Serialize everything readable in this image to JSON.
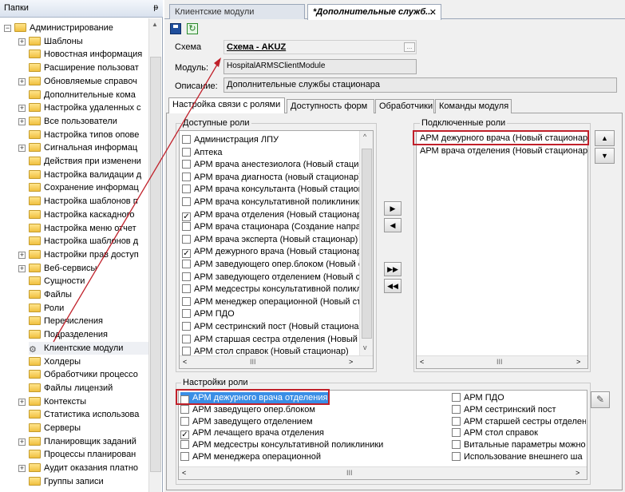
{
  "left_panel": {
    "title": "Папки",
    "pin": "ᵽ",
    "tree": [
      {
        "label": "Администрирование",
        "level": 0,
        "toggle": "−",
        "icon": "folder"
      },
      {
        "label": "Шаблоны",
        "level": 1,
        "toggle": "+",
        "icon": "folder"
      },
      {
        "label": "Новостная информация",
        "level": 1,
        "toggle": "",
        "icon": "folder"
      },
      {
        "label": "Расширение пользоват",
        "level": 1,
        "toggle": "",
        "icon": "folder"
      },
      {
        "label": "Обновляемые справоч",
        "level": 1,
        "toggle": "+",
        "icon": "folder"
      },
      {
        "label": "Дополнительные кома",
        "level": 1,
        "toggle": "",
        "icon": "folder"
      },
      {
        "label": "Настройка удаленных с",
        "level": 1,
        "toggle": "+",
        "icon": "folder"
      },
      {
        "label": "Все пользователи",
        "level": 1,
        "toggle": "+",
        "icon": "folder"
      },
      {
        "label": "Настройка типов опове",
        "level": 1,
        "toggle": "",
        "icon": "folder"
      },
      {
        "label": "Сигнальная информац",
        "level": 1,
        "toggle": "+",
        "icon": "folder"
      },
      {
        "label": "Действия при изменени",
        "level": 1,
        "toggle": "",
        "icon": "folder"
      },
      {
        "label": "Настройка валидации д",
        "level": 1,
        "toggle": "",
        "icon": "folder"
      },
      {
        "label": "Сохранение информац",
        "level": 1,
        "toggle": "",
        "icon": "folder"
      },
      {
        "label": "Настройка шаблонов п",
        "level": 1,
        "toggle": "",
        "icon": "folder"
      },
      {
        "label": "Настройка каскадного",
        "level": 1,
        "toggle": "",
        "icon": "folder"
      },
      {
        "label": "Настройка меню отчет",
        "level": 1,
        "toggle": "",
        "icon": "folder"
      },
      {
        "label": "Настройка шаблонов д",
        "level": 1,
        "toggle": "",
        "icon": "folder"
      },
      {
        "label": "Настройки прав доступ",
        "level": 1,
        "toggle": "+",
        "icon": "folder"
      },
      {
        "label": "Веб-сервисы",
        "level": 1,
        "toggle": "+",
        "icon": "folder"
      },
      {
        "label": "Сущности",
        "level": 1,
        "toggle": "",
        "icon": "folder"
      },
      {
        "label": "Файлы",
        "level": 1,
        "toggle": "",
        "icon": "folder"
      },
      {
        "label": "Роли",
        "level": 1,
        "toggle": "",
        "icon": "folder"
      },
      {
        "label": "Перечисления",
        "level": 1,
        "toggle": "",
        "icon": "folder"
      },
      {
        "label": "Подразделения",
        "level": 1,
        "toggle": "",
        "icon": "folder"
      },
      {
        "label": "Клиентские модули",
        "level": 1,
        "toggle": "",
        "icon": "gear",
        "selected": true
      },
      {
        "label": "Холдеры",
        "level": 1,
        "toggle": "",
        "icon": "folder"
      },
      {
        "label": "Обработчики процессо",
        "level": 1,
        "toggle": "",
        "icon": "folder"
      },
      {
        "label": "Файлы лицензий",
        "level": 1,
        "toggle": "",
        "icon": "folder"
      },
      {
        "label": "Контексты",
        "level": 1,
        "toggle": "+",
        "icon": "folder"
      },
      {
        "label": "Статистика использова",
        "level": 1,
        "toggle": "",
        "icon": "folder"
      },
      {
        "label": "Серверы",
        "level": 1,
        "toggle": "",
        "icon": "folder"
      },
      {
        "label": "Планировщик заданий",
        "level": 1,
        "toggle": "+",
        "icon": "folder"
      },
      {
        "label": "Процессы планирован",
        "level": 1,
        "toggle": "",
        "icon": "folder"
      },
      {
        "label": "Аудит оказания платно",
        "level": 1,
        "toggle": "+",
        "icon": "folder"
      },
      {
        "label": "Группы записи",
        "level": 1,
        "toggle": "",
        "icon": "folder"
      }
    ]
  },
  "doc_tabs": [
    {
      "label": "Клиентские модули",
      "active": false
    },
    {
      "label": "*Дополнительные служб...",
      "active": true,
      "close": "✕"
    }
  ],
  "toolbar": {
    "save_icon": "save-icon",
    "refresh_icon": "refresh-icon"
  },
  "form": {
    "schema_label": "Схема",
    "schema_value": "Схема - AKUZ",
    "schema_button": "...",
    "module_label": "Модуль:",
    "module_value": "HospitalARMSClientModule",
    "desc_label": "Описание:",
    "desc_value": "Дополнительные службы стационара"
  },
  "panel_tabs": [
    {
      "label": "Настройка связи с ролями",
      "active": true
    },
    {
      "label": "Доступность форм",
      "active": false
    },
    {
      "label": "Обработчики",
      "active": false
    },
    {
      "label": "Команды модуля",
      "active": false
    }
  ],
  "available_roles": {
    "title": "Доступные роли",
    "items": [
      {
        "label": "Администрация ЛПУ",
        "checked": false
      },
      {
        "label": "Аптека",
        "checked": false
      },
      {
        "label": "АРМ врача анестезиолога (Новый стацио",
        "checked": false
      },
      {
        "label": "АРМ врача диагноста (новый стационар)",
        "checked": false
      },
      {
        "label": "АРМ врача консультанта (Новый стацион",
        "checked": false
      },
      {
        "label": "АРМ врача консультативной поликлиник",
        "checked": false
      },
      {
        "label": "АРМ врача отделения (Новый стационар)",
        "checked": true
      },
      {
        "label": "АРМ врача стационара (Создание направ",
        "checked": false
      },
      {
        "label": "АРМ врача эксперта (Новый стационар)",
        "checked": false
      },
      {
        "label": "АРМ дежурного врача (Новый стационар",
        "checked": true
      },
      {
        "label": "АРМ заведующего опер.блоком (Новый с",
        "checked": false
      },
      {
        "label": "АРМ заведующего отделением (Новый с",
        "checked": false
      },
      {
        "label": "АРМ медсестры консультативной поликл",
        "checked": false
      },
      {
        "label": "АРМ менеджер операционной (Новый ста",
        "checked": false
      },
      {
        "label": "АРМ ПДО",
        "checked": false
      },
      {
        "label": "АРМ сестринский пост (Новый стационар",
        "checked": false
      },
      {
        "label": "АРМ старшая сестра отделения (Новый с",
        "checked": false
      },
      {
        "label": "АРМ стол справок (Новый стационар)",
        "checked": false
      }
    ],
    "scroll_mid": "III"
  },
  "connected_roles": {
    "title": "Подключенные роли",
    "items": [
      {
        "label": "АРМ дежурного врача (Новый стационар)"
      },
      {
        "label": "АРМ врача отделения (Новый стационар)"
      }
    ],
    "scroll_mid": "III"
  },
  "move_buttons": {
    "add": "▶",
    "remove": "◀",
    "add_all": "▶▶",
    "remove_all": "◀◀",
    "up": "▲",
    "down": "▼"
  },
  "role_settings": {
    "title": "Настройки роли",
    "col1": [
      {
        "label": "АРМ дежурного врача отделения",
        "checked": true,
        "selected": true
      },
      {
        "label": "АРМ заведущего опер.блоком",
        "checked": false
      },
      {
        "label": "АРМ заведущего отделением",
        "checked": false
      },
      {
        "label": "АРМ лечащего врача отделения",
        "checked": true
      },
      {
        "label": "АРМ медсестры консультативной поликлиники",
        "checked": false
      },
      {
        "label": "АРМ менеджера операционной",
        "checked": false
      }
    ],
    "col2": [
      {
        "label": "АРМ ПДО",
        "checked": false
      },
      {
        "label": "АРМ сестринский пост",
        "checked": false
      },
      {
        "label": "АРМ старшей сестры отделен",
        "checked": false
      },
      {
        "label": "АРМ стол справок",
        "checked": false
      },
      {
        "label": "Витальные параметры можно",
        "checked": false
      },
      {
        "label": "Использование внешнего ша",
        "checked": false
      }
    ],
    "edit_icon": "pencil-icon",
    "scroll_mid": "III"
  },
  "annotation_color": "#c0202a"
}
